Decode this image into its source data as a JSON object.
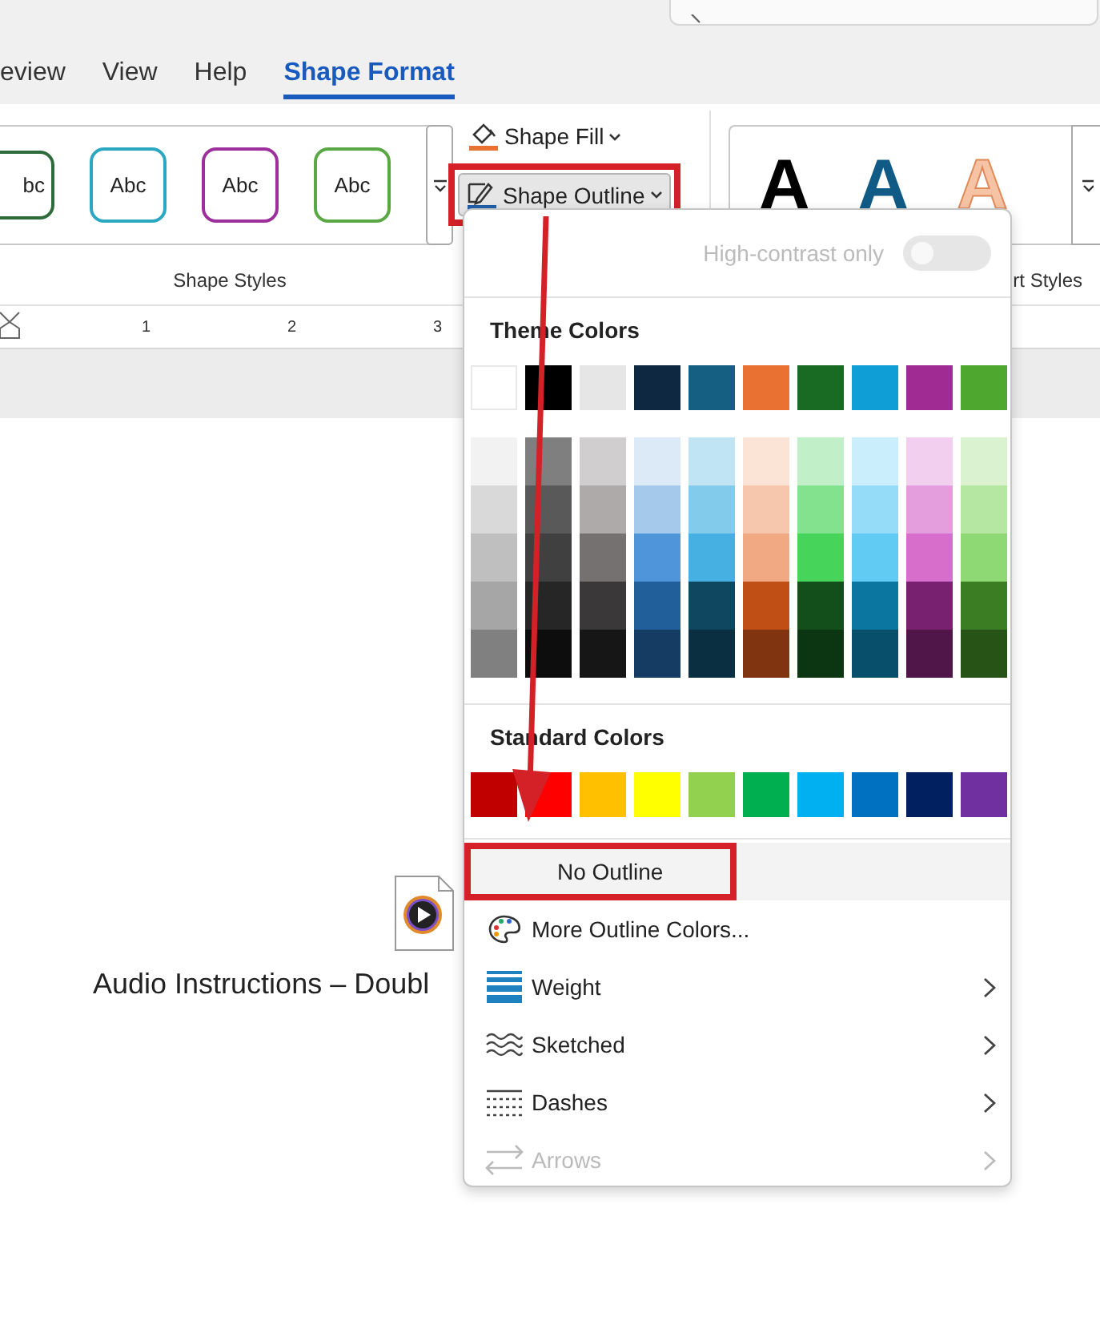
{
  "ribbon_tabs": [
    {
      "label": "eview",
      "selected": false
    },
    {
      "label": "View",
      "selected": false
    },
    {
      "label": "Help",
      "selected": false
    },
    {
      "label": "Shape Format",
      "selected": true
    }
  ],
  "shape_styles": {
    "presets": [
      {
        "label": "bc",
        "color": "#2e6b3a"
      },
      {
        "label": "Abc",
        "color": "#2ba7c2"
      },
      {
        "label": "Abc",
        "color": "#9c2f9c"
      },
      {
        "label": "Abc",
        "color": "#5aa844"
      }
    ],
    "group_label": "Shape Styles"
  },
  "shape_fill": {
    "label": "Shape Fill"
  },
  "shape_outline": {
    "label": "Shape Outline",
    "annotated": true
  },
  "wordart_styles": {
    "presets": [
      {
        "label": "A",
        "color": "#000000"
      },
      {
        "label": "A",
        "color": "#0f5b85"
      },
      {
        "label": "A",
        "color": "#f6c3a5"
      }
    ],
    "group_label": "rt Styles"
  },
  "ruler": {
    "labels": [
      "1",
      "2",
      "3"
    ]
  },
  "document": {
    "attachment_caption": "Audio Instructions – Doubl"
  },
  "outline_menu": {
    "high_contrast": {
      "label": "High-contrast only",
      "on": false,
      "disabled": true
    },
    "theme_colors": {
      "heading": "Theme Colors",
      "base": [
        {
          "color": "#ffffff"
        },
        {
          "color": "#000000"
        },
        {
          "color": "#e7e6e6"
        },
        {
          "color": "#0e2841"
        },
        {
          "color": "#156082"
        },
        {
          "color": "#e97132"
        },
        {
          "color": "#196b24"
        },
        {
          "color": "#0f9ed5"
        },
        {
          "color": "#a02b93"
        },
        {
          "color": "#4ea72e"
        }
      ],
      "columns": [
        {
          "shades": [
            {
              "color": "#f2f2f2"
            },
            {
              "color": "#d9d9d9"
            },
            {
              "color": "#bfbfbf"
            },
            {
              "color": "#a6a6a6"
            },
            {
              "color": "#808080"
            }
          ]
        },
        {
          "shades": [
            {
              "color": "#7f7f7f"
            },
            {
              "color": "#595959"
            },
            {
              "color": "#404040"
            },
            {
              "color": "#262626"
            },
            {
              "color": "#0d0d0d"
            }
          ]
        },
        {
          "shades": [
            {
              "color": "#d0cece"
            },
            {
              "color": "#aeaaaa"
            },
            {
              "color": "#757171"
            },
            {
              "color": "#3a3838"
            },
            {
              "color": "#161616"
            }
          ]
        },
        {
          "shades": [
            {
              "color": "#dceaf7"
            },
            {
              "color": "#a5c9eb"
            },
            {
              "color": "#4e95d9"
            },
            {
              "color": "#215f9a"
            },
            {
              "color": "#153d64"
            }
          ]
        },
        {
          "shades": [
            {
              "color": "#c1e4f5"
            },
            {
              "color": "#83cbeb"
            },
            {
              "color": "#45b0e1"
            },
            {
              "color": "#0f4761"
            },
            {
              "color": "#0a2f40"
            }
          ]
        },
        {
          "shades": [
            {
              "color": "#fbe3d6"
            },
            {
              "color": "#f6c6ad"
            },
            {
              "color": "#f1a983"
            },
            {
              "color": "#c04f15"
            },
            {
              "color": "#803510"
            }
          ]
        },
        {
          "shades": [
            {
              "color": "#c1f0c8"
            },
            {
              "color": "#83e28e"
            },
            {
              "color": "#47d45a"
            },
            {
              "color": "#124f1a"
            },
            {
              "color": "#0c3511"
            }
          ]
        },
        {
          "shades": [
            {
              "color": "#caeefb"
            },
            {
              "color": "#94dcf8"
            },
            {
              "color": "#61cbf3"
            },
            {
              "color": "#0b76a0"
            },
            {
              "color": "#074f6a"
            }
          ]
        },
        {
          "shades": [
            {
              "color": "#f2ceef"
            },
            {
              "color": "#e49edd"
            },
            {
              "color": "#d86ecc"
            },
            {
              "color": "#782170"
            },
            {
              "color": "#501549"
            }
          ]
        },
        {
          "shades": [
            {
              "color": "#daf2d0"
            },
            {
              "color": "#b5e6a2"
            },
            {
              "color": "#8ed973"
            },
            {
              "color": "#3b7d23"
            },
            {
              "color": "#275317"
            }
          ]
        }
      ]
    },
    "standard_colors": {
      "heading": "Standard Colors",
      "swatches": [
        {
          "color": "#c00000"
        },
        {
          "color": "#ff0000"
        },
        {
          "color": "#ffc000"
        },
        {
          "color": "#ffff00"
        },
        {
          "color": "#92d050"
        },
        {
          "color": "#00b050"
        },
        {
          "color": "#00b0f0"
        },
        {
          "color": "#0070c0"
        },
        {
          "color": "#002060"
        },
        {
          "color": "#7030a0"
        }
      ]
    },
    "items": [
      {
        "kind": "none",
        "label": "No Outline",
        "highlighted": true,
        "annotated": true,
        "submenu": false,
        "disabled": false
      },
      {
        "kind": "palette",
        "label": "More Outline Colors...",
        "highlighted": false,
        "annotated": false,
        "submenu": false,
        "disabled": false
      },
      {
        "kind": "weight",
        "label": "Weight",
        "highlighted": false,
        "annotated": false,
        "submenu": true,
        "disabled": false
      },
      {
        "kind": "sketched",
        "label": "Sketched",
        "highlighted": false,
        "annotated": false,
        "submenu": true,
        "disabled": false
      },
      {
        "kind": "dashes",
        "label": "Dashes",
        "highlighted": false,
        "annotated": false,
        "submenu": true,
        "disabled": false
      },
      {
        "kind": "arrows",
        "label": "Arrows",
        "highlighted": false,
        "annotated": false,
        "submenu": true,
        "disabled": true
      }
    ]
  }
}
